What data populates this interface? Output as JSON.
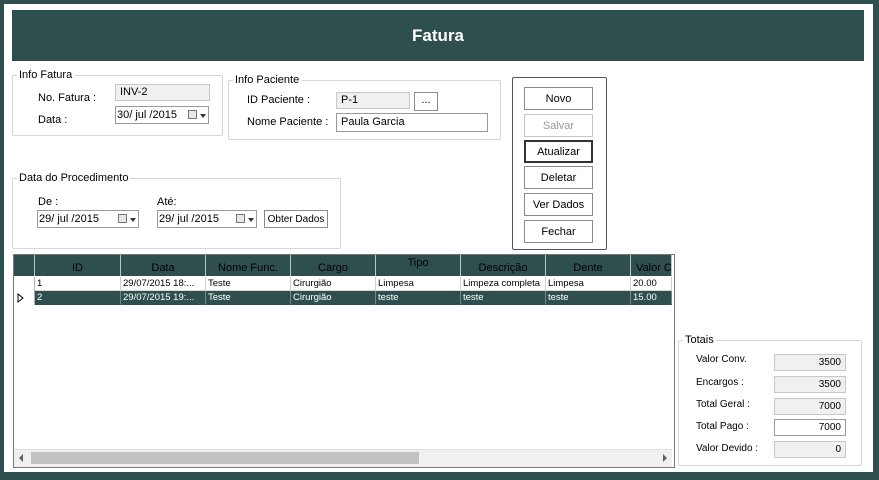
{
  "window": {
    "title": "Fatura"
  },
  "info_fatura": {
    "legend": "Info Fatura",
    "no_fatura_label": "No. Fatura :",
    "no_fatura_value": "INV-2",
    "data_label": "Data :",
    "data_value": "30/ jul /2015"
  },
  "info_paciente": {
    "legend": "Info Paciente",
    "id_label": "ID Paciente :",
    "id_value": "P-1",
    "browse_label": "...",
    "nome_label": "Nome Paciente :",
    "nome_value": "Paula Garcia"
  },
  "actions": {
    "novo": "Novo",
    "salvar": "Salvar",
    "atualizar": "Atualizar",
    "deletar": "Deletar",
    "ver_dados": "Ver Dados",
    "fechar": "Fechar"
  },
  "procedimento": {
    "legend": "Data do Procedimento",
    "de_label": "De :",
    "de_value": "29/ jul /2015",
    "ate_label": "Até:",
    "ate_value": "29/ jul /2015",
    "obter_label": "Obter Dados"
  },
  "grid": {
    "columns": [
      "ID",
      "Data",
      "Nome Func.",
      "Cargo",
      "Tipo",
      "Descrição",
      "Dente",
      "Valor C"
    ],
    "rows": [
      [
        "1",
        "29/07/2015 18:...",
        "Teste",
        "Cirurgião",
        "Limpesa",
        "Limpeza completa",
        "Limpesa",
        "20.00"
      ],
      [
        "2",
        "29/07/2015 19:...",
        "Teste",
        "Cirurgião",
        "teste",
        "teste",
        "teste",
        "15.00"
      ]
    ]
  },
  "totais": {
    "legend": "Totais",
    "valor_conv_label": "Valor Conv.",
    "valor_conv": "3500",
    "encargos_label": "Encargos :",
    "encargos": "3500",
    "total_geral_label": "Total Geral :",
    "total_geral": "7000",
    "total_pago_label": "Total Pago :",
    "total_pago": "7000",
    "valor_devido_label": "Valor Devido :",
    "valor_devido": "0"
  },
  "colors": {
    "header_bg": "#2f4f4f",
    "selected_row": "#2f4f4f"
  }
}
